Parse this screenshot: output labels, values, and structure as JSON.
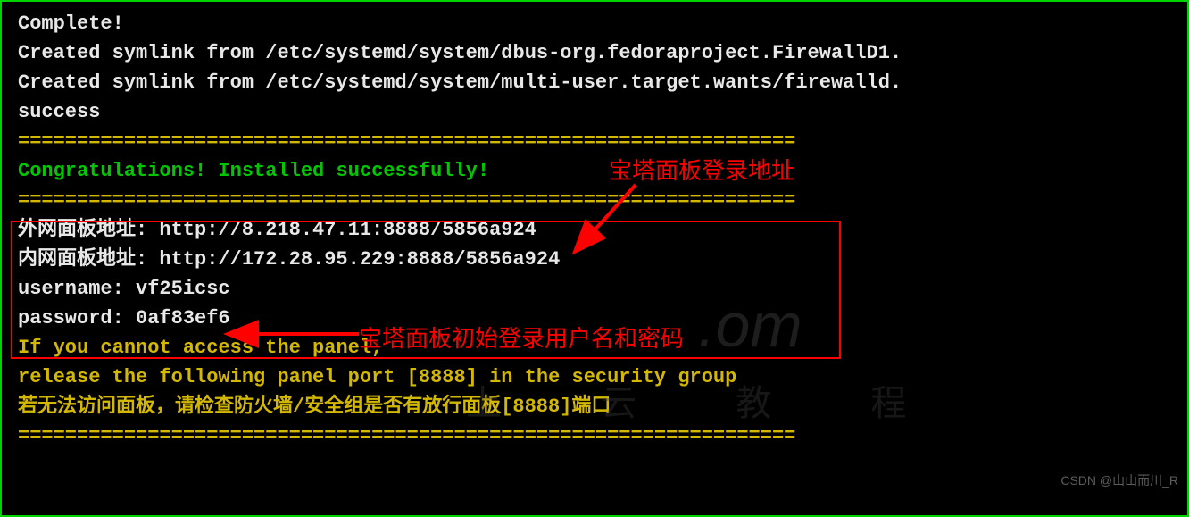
{
  "terminal": {
    "line1": "Complete!",
    "line2": "Created symlink from /etc/systemd/system/dbus-org.fedoraproject.FirewallD1.",
    "line3": "Created symlink from /etc/systemd/system/multi-user.target.wants/firewalld.",
    "line4": "success",
    "sep1": "==================================================================",
    "congrats": "Congratulations! Installed successfully!",
    "sep2": "==================================================================",
    "panel_external": "外网面板地址: http://8.218.47.11:8888/5856a924",
    "panel_internal": "内网面板地址: http://172.28.95.229:8888/5856a924",
    "username_line": "username: vf25icsc",
    "password_line": "password: 0af83ef6",
    "hint1": "If you cannot access the panel,",
    "hint2": "release the following panel port [8888] in the security group",
    "hint3": "若无法访问面板，请检查防火墙/安全组是否有放行面板[8888]端口",
    "sep3": "=================================================================="
  },
  "annotations": {
    "login_url_label": "宝塔面板登录地址",
    "credentials_label": "宝塔面板初始登录用户名和密码"
  },
  "watermark": {
    "wm1": ".om",
    "wm2": "上 云 教 程",
    "csdn": "CSDN @山山而川_R"
  }
}
